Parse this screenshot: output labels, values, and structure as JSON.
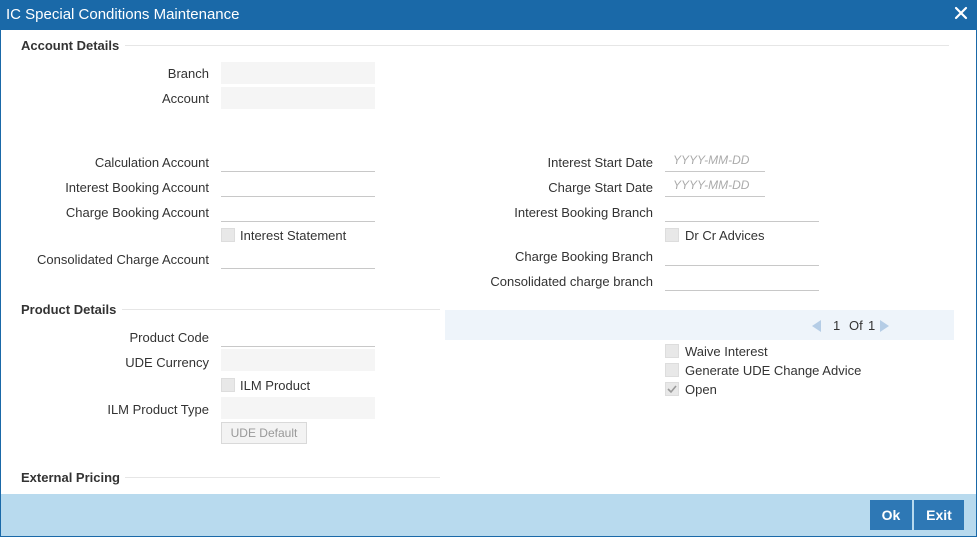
{
  "window": {
    "title": "IC Special Conditions Maintenance"
  },
  "account_details": {
    "title": "Account Details",
    "branch_label": "Branch",
    "account_label": "Account",
    "calc_account_label": "Calculation Account",
    "int_booking_account_label": "Interest Booking Account",
    "charge_booking_account_label": "Charge Booking Account",
    "interest_statement_label": "Interest Statement",
    "consolidated_charge_account_label": "Consolidated Charge Account",
    "interest_start_date_label": "Interest Start Date",
    "interest_start_date_placeholder": "YYYY-MM-DD",
    "charge_start_date_label": "Charge Start Date",
    "charge_start_date_placeholder": "YYYY-MM-DD",
    "interest_booking_branch_label": "Interest Booking Branch",
    "dr_cr_advices_label": "Dr Cr Advices",
    "charge_booking_branch_label": "Charge Booking Branch",
    "consolidated_charge_branch_label": "Consolidated charge branch"
  },
  "product_details": {
    "title": "Product Details",
    "product_code_label": "Product Code",
    "ude_currency_label": "UDE Currency",
    "ilm_product_label": "ILM Product",
    "ilm_product_type_label": "ILM Product Type",
    "ude_default_label": "UDE Default",
    "pager": {
      "current": "1",
      "of_label": "Of",
      "total": "1"
    },
    "waive_interest_label": "Waive Interest",
    "generate_ude_label": "Generate UDE Change Advice",
    "open_label": "Open"
  },
  "external_pricing": {
    "title": "External Pricing"
  },
  "footer": {
    "ok_label": "Ok",
    "exit_label": "Exit"
  },
  "colors": {
    "titlebar": "#1a69a8",
    "footer": "#b8daee",
    "button": "#2e78b5"
  }
}
